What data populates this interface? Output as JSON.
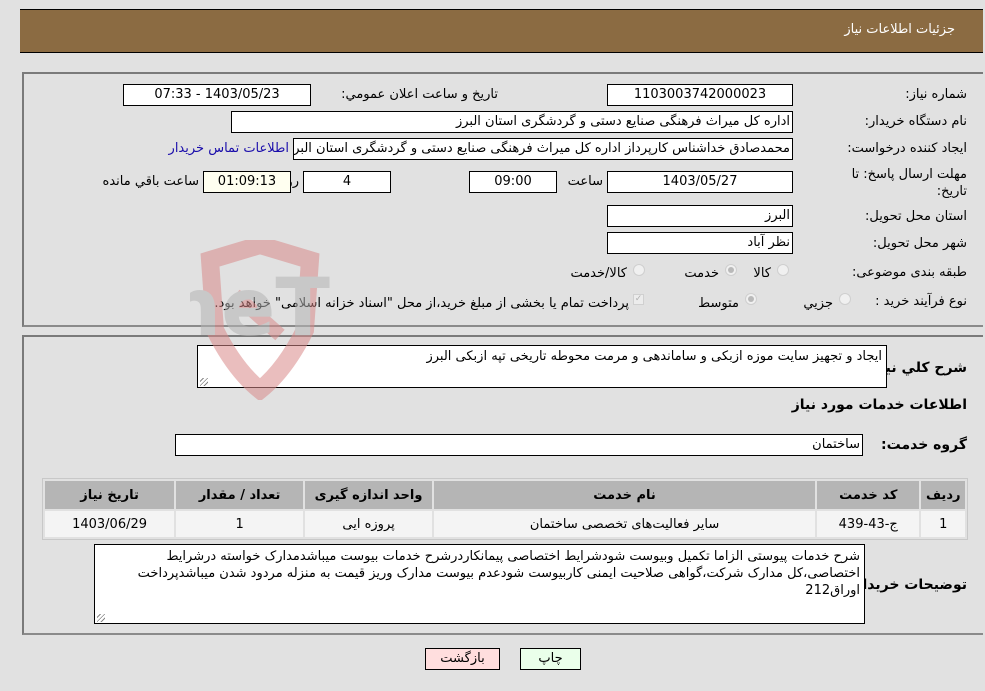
{
  "header": {
    "title": "جزئیات اطلاعات نیاز"
  },
  "form": {
    "need_number": {
      "label": "شماره نیاز:",
      "value": "1103003742000023"
    },
    "announce_datetime": {
      "label": "تاریخ و ساعت اعلان عمومي:",
      "value": "1403/05/23 - 07:33"
    },
    "buyer_org": {
      "label": "نام دستگاه خریدار:",
      "value": "اداره کل میراث فرهنگی  صنایع دستی و گردشگری استان البرز"
    },
    "requester": {
      "label": "ایجاد کننده درخواست:",
      "value": "محمدصادق خداشناس  کارپرداز اداره کل میراث فرهنگی  صنایع دستی و گردشگری استان البرز",
      "contact_link": "اطلاعات تماس خریدار"
    },
    "deadline": {
      "label": "مهلت ارسال پاسخ: تا تاریخ:",
      "date": "1403/05/27",
      "time_label": "ساعت",
      "time": "09:00",
      "days": "4",
      "days_label": "روز و",
      "remaining": "01:09:13",
      "remaining_label": "ساعت باقي مانده"
    },
    "delivery_province": {
      "label": "استان محل تحویل:",
      "value": "البرز"
    },
    "delivery_city": {
      "label": "شهر محل تحویل:",
      "value": "نظر آباد"
    },
    "category": {
      "label": "طبقه بندی موضوعی:",
      "options": [
        "کالا",
        "خدمت",
        "کالا/خدمت"
      ],
      "selected": "خدمت"
    },
    "purchase_process": {
      "label": "نوع فرآیند خرید :",
      "options": [
        "جزيي",
        "متوسط"
      ],
      "selected": "متوسط",
      "treasury_note": "پرداخت تمام یا بخشی از مبلغ خرید،از محل \"اسناد خزانه اسلامی\" خواهد بود.",
      "treasury_checked": true
    }
  },
  "details": {
    "summary": {
      "label": "شرح کلي نياز:",
      "value": "ایجاد و تجهیز سایت موزه ازبکی و ساماندهی و مرمت محوطه تاریخی تپه ازبکی البرز"
    },
    "services_title": "اطلاعات خدمات مورد نياز",
    "service_group": {
      "label": "گروه خدمت:",
      "value": "ساختمان"
    },
    "table": {
      "columns": [
        "رديف",
        "کد خدمت",
        "نام خدمت",
        "واحد اندازه گیری",
        "تعداد / مقدار",
        "تاریخ نیاز"
      ],
      "rows": [
        [
          "1",
          "ج-43-439",
          "سایر فعالیت‌های تخصصی ساختمان",
          "پروزه ایی",
          "1",
          "1403/06/29"
        ]
      ]
    },
    "buyer_notes": {
      "label": "توضیحات خریدار:",
      "value": "شرح خدمات پیوستی الزاما تکمیل وبیوست شودشرایط اختصاصی پیمانکاردرشرح خدمات بیوست میباشدمدارک خواسته درشرایط اختصاصی،کل مدارک شرکت،گواهی صلاحیت ایمنی کاربیوست شودعدم بیوست مدارک وریز قیمت به منزله مردود شدن میباشدپرداخت اوراق212"
    }
  },
  "buttons": {
    "print": "چاپ",
    "back": "بازگشت"
  },
  "watermark": {
    "text": "AriaTender.neT"
  },
  "colors": {
    "header_bg": "#8b6b42",
    "print_bg": "#eaffea",
    "back_bg": "#ffdede",
    "link": "#1a0dab"
  }
}
